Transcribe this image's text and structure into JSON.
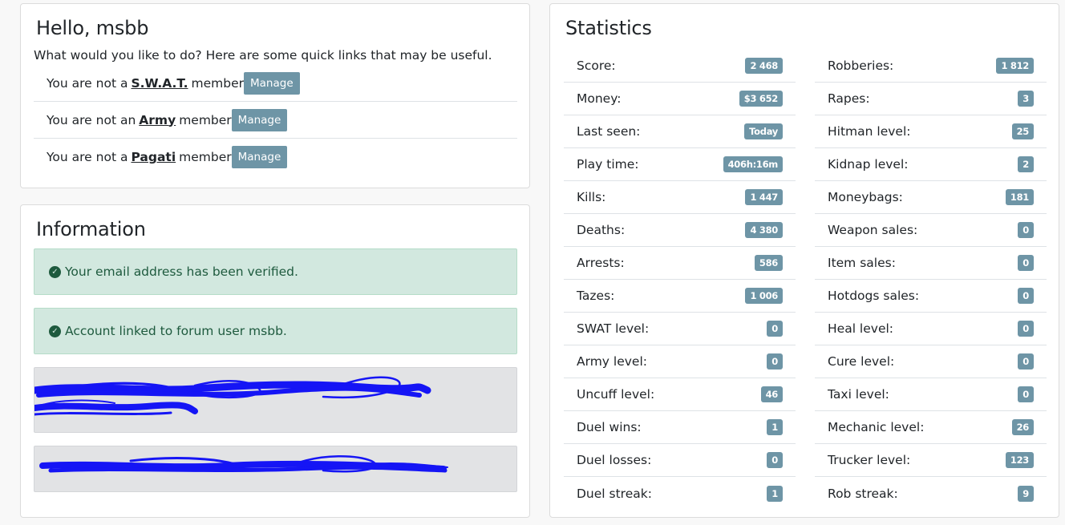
{
  "hello": {
    "title": "Hello, msbb",
    "intro": "What would you like to do? Here are some quick links that may be useful.",
    "memberships": [
      {
        "prefix": "You are not a",
        "group": "S.W.A.T.",
        "suffix": "member",
        "button": "Manage"
      },
      {
        "prefix": "You are not an",
        "group": "Army",
        "suffix": "member",
        "button": "Manage"
      },
      {
        "prefix": "You are not a",
        "group": "Pagati",
        "suffix": "member",
        "button": "Manage"
      }
    ]
  },
  "information": {
    "title": "Information",
    "alerts": [
      {
        "text": "Your email address has been verified.",
        "icon": "check-circle-icon"
      },
      {
        "text": "Account linked to forum user msbb.",
        "icon": "check-circle-icon"
      }
    ]
  },
  "statistics": {
    "title": "Statistics",
    "left": [
      {
        "label": "Score:",
        "value": "2 468"
      },
      {
        "label": "Money:",
        "value": "$3 652"
      },
      {
        "label": "Last seen:",
        "value": "Today"
      },
      {
        "label": "Play time:",
        "value": "406h:16m"
      },
      {
        "label": "Kills:",
        "value": "1 447"
      },
      {
        "label": "Deaths:",
        "value": "4 380"
      },
      {
        "label": "Arrests:",
        "value": "586"
      },
      {
        "label": "Tazes:",
        "value": "1 006"
      },
      {
        "label": "SWAT level:",
        "value": "0"
      },
      {
        "label": "Army level:",
        "value": "0"
      },
      {
        "label": "Uncuff level:",
        "value": "46"
      },
      {
        "label": "Duel wins:",
        "value": "1"
      },
      {
        "label": "Duel losses:",
        "value": "0"
      },
      {
        "label": "Duel streak:",
        "value": "1"
      }
    ],
    "right": [
      {
        "label": "Robberies:",
        "value": "1 812"
      },
      {
        "label": "Rapes:",
        "value": "3"
      },
      {
        "label": "Hitman level:",
        "value": "25"
      },
      {
        "label": "Kidnap level:",
        "value": "2"
      },
      {
        "label": "Moneybags:",
        "value": "181"
      },
      {
        "label": "Weapon sales:",
        "value": "0"
      },
      {
        "label": "Item sales:",
        "value": "0"
      },
      {
        "label": "Hotdogs sales:",
        "value": "0"
      },
      {
        "label": "Heal level:",
        "value": "0"
      },
      {
        "label": "Cure level:",
        "value": "0"
      },
      {
        "label": "Taxi level:",
        "value": "0"
      },
      {
        "label": "Mechanic level:",
        "value": "26"
      },
      {
        "label": "Trucker level:",
        "value": "123"
      },
      {
        "label": "Rob streak:",
        "value": "9"
      }
    ]
  },
  "colors": {
    "badge": "#6e95a6",
    "alert_bg": "#d2e8df",
    "alert_text": "#1e5a3e",
    "scribble": "#1515f5"
  }
}
